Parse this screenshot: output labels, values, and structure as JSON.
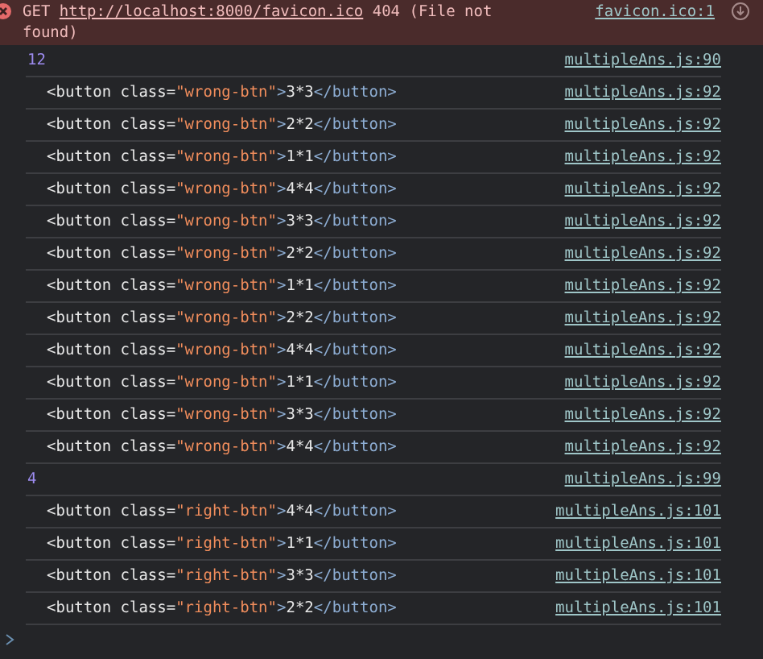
{
  "error": {
    "method": "GET",
    "url": "http://localhost:8000/favicon.ico",
    "status": "404 (File not found)",
    "source": "favicon.ico:1"
  },
  "logs": [
    {
      "kind": "value",
      "text": "12",
      "source": "multipleAns.js:90"
    },
    {
      "kind": "element",
      "text": "<button class=\"wrong-btn\">3*3</button>",
      "source": "multipleAns.js:92"
    },
    {
      "kind": "element",
      "text": "<button class=\"wrong-btn\">2*2</button>",
      "source": "multipleAns.js:92"
    },
    {
      "kind": "element",
      "text": "<button class=\"wrong-btn\">1*1</button>",
      "source": "multipleAns.js:92"
    },
    {
      "kind": "element",
      "text": "<button class=\"wrong-btn\">4*4</button>",
      "source": "multipleAns.js:92"
    },
    {
      "kind": "element",
      "text": "<button class=\"wrong-btn\">3*3</button>",
      "source": "multipleAns.js:92"
    },
    {
      "kind": "element",
      "text": "<button class=\"wrong-btn\">2*2</button>",
      "source": "multipleAns.js:92"
    },
    {
      "kind": "element",
      "text": "<button class=\"wrong-btn\">1*1</button>",
      "source": "multipleAns.js:92"
    },
    {
      "kind": "element",
      "text": "<button class=\"wrong-btn\">2*2</button>",
      "source": "multipleAns.js:92"
    },
    {
      "kind": "element",
      "text": "<button class=\"wrong-btn\">4*4</button>",
      "source": "multipleAns.js:92"
    },
    {
      "kind": "element",
      "text": "<button class=\"wrong-btn\">1*1</button>",
      "source": "multipleAns.js:92"
    },
    {
      "kind": "element",
      "text": "<button class=\"wrong-btn\">3*3</button>",
      "source": "multipleAns.js:92"
    },
    {
      "kind": "element",
      "text": "<button class=\"wrong-btn\">4*4</button>",
      "source": "multipleAns.js:92"
    },
    {
      "kind": "value",
      "text": "4",
      "source": "multipleAns.js:99"
    },
    {
      "kind": "element",
      "text": "<button class=\"right-btn\">4*4</button>",
      "source": "multipleAns.js:101"
    },
    {
      "kind": "element",
      "text": "<button class=\"right-btn\">1*1</button>",
      "source": "multipleAns.js:101"
    },
    {
      "kind": "element",
      "text": "<button class=\"right-btn\">3*3</button>",
      "source": "multipleAns.js:101"
    },
    {
      "kind": "element",
      "text": "<button class=\"right-btn\">2*2</button>",
      "source": "multipleAns.js:101"
    }
  ]
}
